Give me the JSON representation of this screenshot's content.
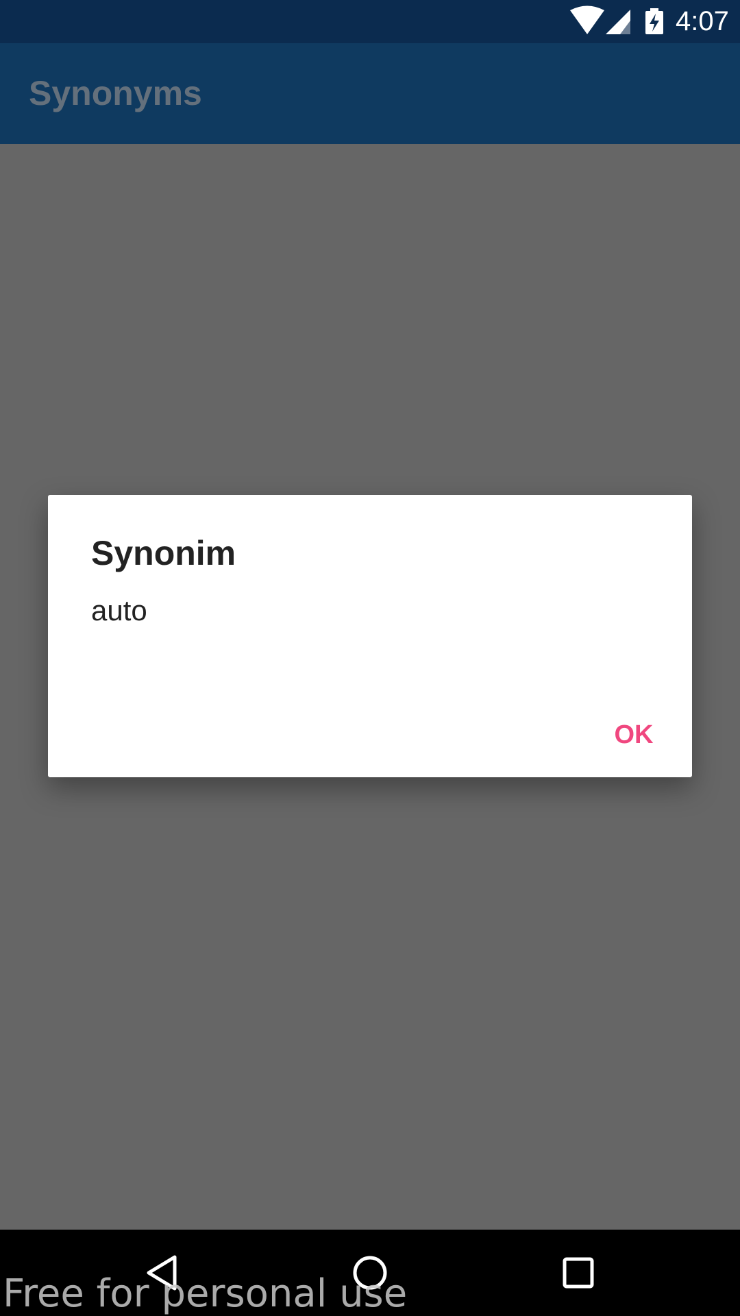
{
  "status_bar": {
    "time": "4:07",
    "icons": [
      "wifi-icon",
      "cell-signal-icon",
      "battery-charging-icon"
    ]
  },
  "app_bar": {
    "title": "Synonyms"
  },
  "dialog": {
    "title": "Synonim",
    "message": "auto",
    "ok_label": "OK"
  },
  "nav_bar": {
    "icons": [
      "back-icon",
      "home-icon",
      "recents-icon"
    ]
  },
  "watermark": "Free for personal use",
  "colors": {
    "status_bar": "#0b2b4f",
    "app_bar": "#0f3a60",
    "scrim": "#666666",
    "accent": "#f0477f"
  }
}
